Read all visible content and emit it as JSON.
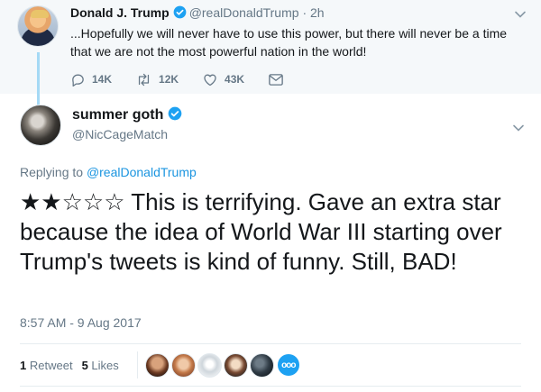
{
  "parent_tweet": {
    "author_name": "Donald J. Trump",
    "handle": "@realDonaldTrump",
    "time": "· 2h",
    "text": "...Hopefully we will never have to use this power, but there will never be a time that we are not the most powerful nation in the world!",
    "replies": "14K",
    "retweets": "12K",
    "likes": "43K"
  },
  "focused_tweet": {
    "author_name": "summer goth",
    "handle": "@NicCageMatch",
    "replying_label": "Replying to",
    "replying_to": "@realDonaldTrump",
    "text": "★★☆☆☆ This is terrifying. Gave an extra star because the idea of World War III starting over Trump's tweets is kind of funny. Still, BAD!",
    "timestamp": "8:57 AM - 9 Aug 2017",
    "retweet_count": "1",
    "retweet_label": "Retweet",
    "like_count": "5",
    "like_label": "Likes",
    "more_likers": "ooo"
  },
  "colors": {
    "accent": "#1da1f2",
    "link": "#1b95e0",
    "muted": "#657786",
    "parent_bg": "#f5f8fa",
    "thread_line": "#a4d9f5"
  },
  "icons": [
    "verified-badge-icon",
    "chevron-down-icon",
    "reply-icon",
    "retweet-icon",
    "like-icon",
    "direct-message-icon"
  ]
}
